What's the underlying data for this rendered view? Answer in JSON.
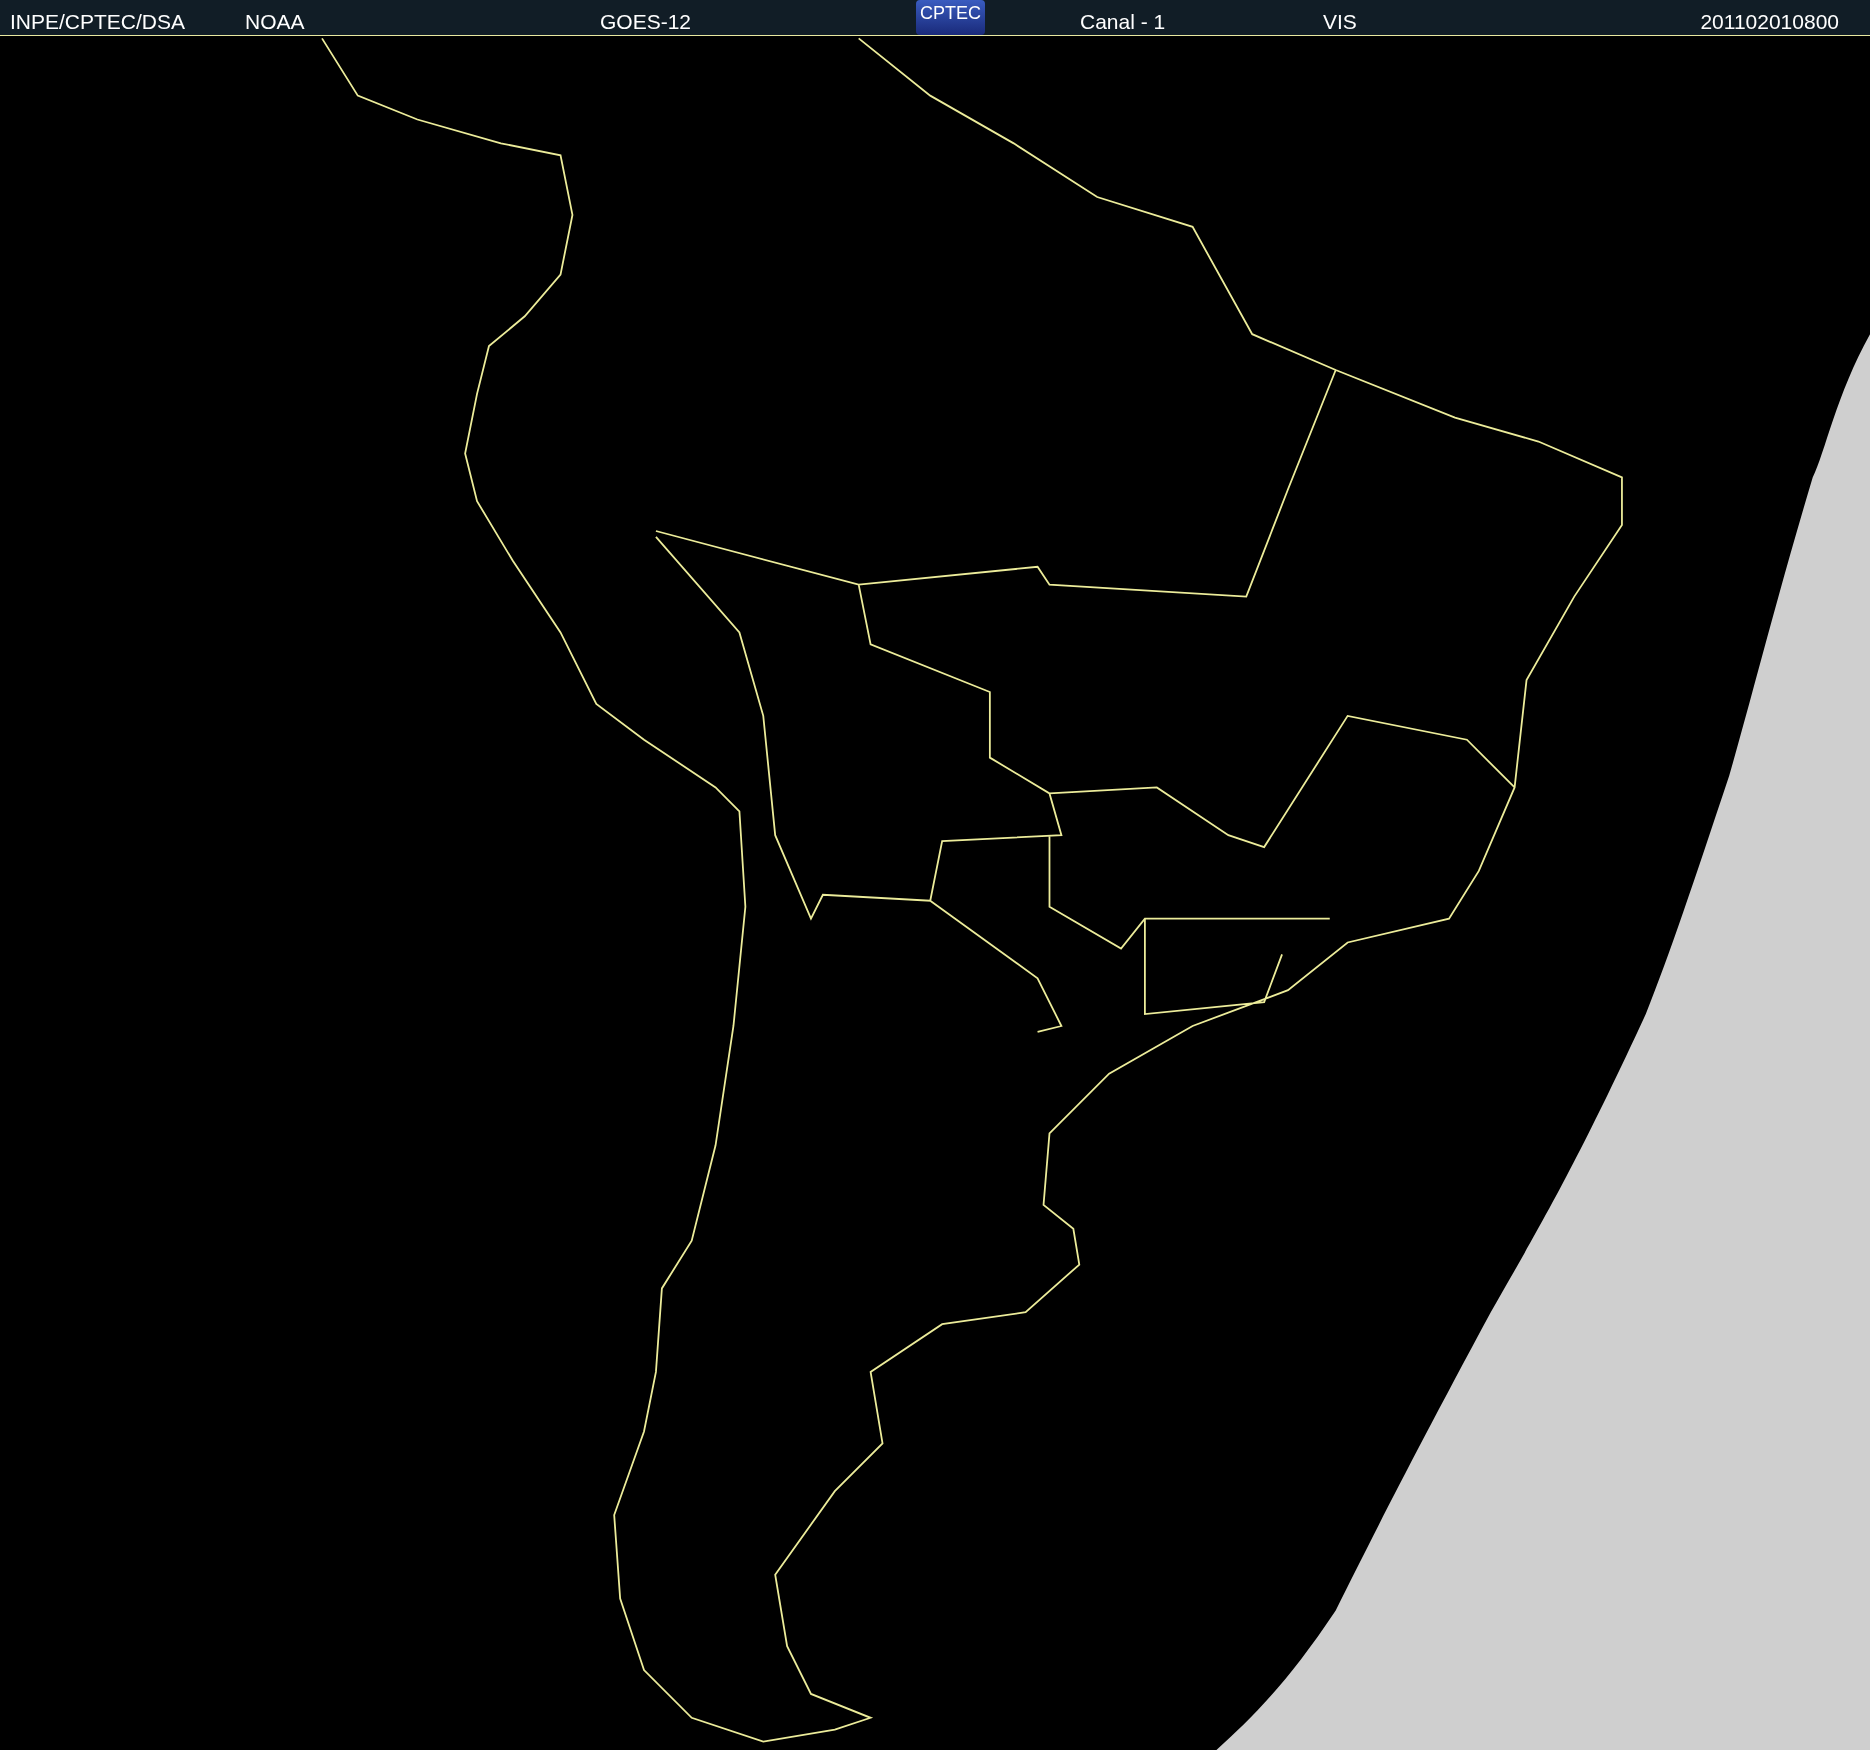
{
  "header": {
    "items": [
      {
        "text": "INPE/CPTEC/DSA"
      },
      {
        "text": "NOAA"
      },
      {
        "text": "GOES-12"
      }
    ],
    "logo": {
      "text": "CPTEC"
    },
    "items_right": [
      {
        "text": "Canal - 1"
      },
      {
        "text": "VIS"
      }
    ],
    "timestamp": "201102010800"
  }
}
